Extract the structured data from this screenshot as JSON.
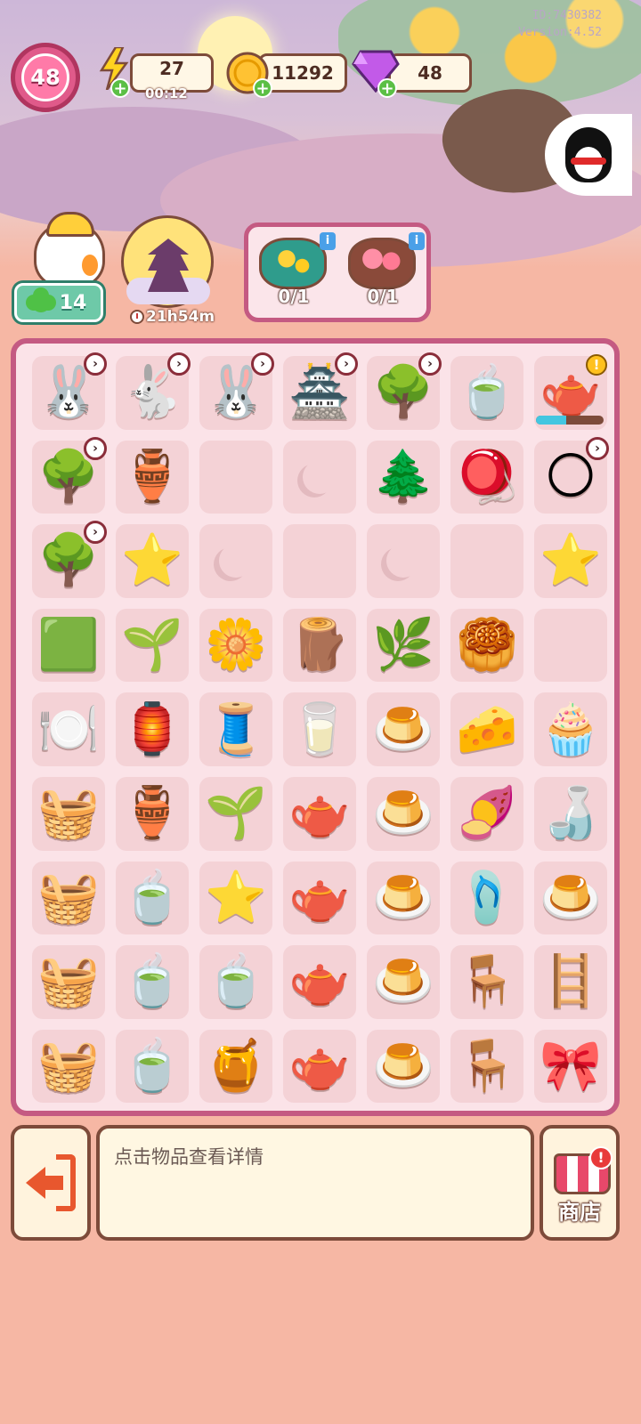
{
  "debug": {
    "id": "ID:7430382",
    "version": "Version:4.52"
  },
  "hud": {
    "level": "48",
    "energy": {
      "value": "27",
      "timer": "00:12"
    },
    "coins": {
      "value": "11292"
    },
    "gems": {
      "value": "48"
    },
    "plus": "+"
  },
  "character": {
    "clover_count": "14"
  },
  "event": {
    "time_left": "21h54m"
  },
  "orders": [
    {
      "count": "0/1",
      "icon": "osmanthus-leaf-plate",
      "info": "i"
    },
    {
      "count": "0/1",
      "icon": "flower-mooncake-box",
      "info": "i"
    }
  ],
  "board": {
    "rows": [
      [
        {
          "icon": "bunny-mortar-generator",
          "glyph": "🐰",
          "locked": true
        },
        {
          "icon": "bunny-golden-mortar-generator",
          "glyph": "🐇",
          "locked": true
        },
        {
          "icon": "grey-bunny-bucket-generator",
          "glyph": "🐰",
          "locked": true
        },
        {
          "icon": "blue-pavilion-generator",
          "glyph": "🏯",
          "locked": true
        },
        {
          "icon": "golden-osmanthus-tree-generator",
          "glyph": "🌳",
          "locked": true
        },
        {
          "icon": "bunny-teacup-item",
          "glyph": "🍵",
          "locked": false
        },
        {
          "icon": "red-teapot-generator",
          "glyph": "🫖",
          "locked": false,
          "alert": true,
          "progress": 0.45
        }
      ],
      [
        {
          "icon": "moon-tree-generator",
          "glyph": "🌳",
          "locked": true
        },
        {
          "icon": "starry-jar-item",
          "glyph": "🏺",
          "locked": false
        },
        {
          "icon": "empty",
          "glyph": "",
          "locked": false,
          "empty": true
        },
        {
          "icon": "empty-moon-slot",
          "glyph": "",
          "locked": false,
          "empty": true,
          "moon": true
        },
        {
          "icon": "bonsai-tree-item",
          "glyph": "🌲",
          "locked": false
        },
        {
          "icon": "wooden-spinning-top-item",
          "glyph": "🪀",
          "locked": false
        },
        {
          "icon": "full-moon-item",
          "glyph": "🌕",
          "locked": true
        }
      ],
      [
        {
          "icon": "moon-tree-generator",
          "glyph": "🌳",
          "locked": true
        },
        {
          "icon": "star-chest-item",
          "glyph": "⭐",
          "locked": false
        },
        {
          "icon": "empty-moon-slot",
          "glyph": "",
          "locked": false,
          "empty": true,
          "moon": true
        },
        {
          "icon": "empty",
          "glyph": "",
          "locked": false,
          "empty": true
        },
        {
          "icon": "empty-moon-slot",
          "glyph": "",
          "locked": false,
          "empty": true,
          "moon": true
        },
        {
          "icon": "empty",
          "glyph": "",
          "locked": false,
          "empty": true
        },
        {
          "icon": "small-star-item",
          "glyph": "⭐",
          "locked": false
        }
      ],
      [
        {
          "icon": "green-tray-item",
          "glyph": "🟩",
          "locked": false
        },
        {
          "icon": "sprout-item",
          "glyph": "🌱",
          "locked": false
        },
        {
          "icon": "osmanthus-flowers-item",
          "glyph": "🌼",
          "locked": false
        },
        {
          "icon": "branch-item",
          "glyph": "🪵",
          "locked": false
        },
        {
          "icon": "osmanthus-twig-item",
          "glyph": "🌿",
          "locked": false
        },
        {
          "icon": "mooncake-item",
          "glyph": "🥮",
          "locked": false
        },
        {
          "icon": "empty",
          "glyph": "",
          "locked": false,
          "empty": true
        }
      ],
      [
        {
          "icon": "jade-plate-item",
          "glyph": "🍽️",
          "locked": false
        },
        {
          "icon": "golden-lantern-item",
          "glyph": "🏮",
          "locked": false
        },
        {
          "icon": "thread-spool-item",
          "glyph": "🧵",
          "locked": false
        },
        {
          "icon": "starry-cup-item",
          "glyph": "🥛",
          "locked": false
        },
        {
          "icon": "osmanthus-jelly-item",
          "glyph": "🍮",
          "locked": false
        },
        {
          "icon": "cheese-mooncake-item",
          "glyph": "🧀",
          "locked": false
        },
        {
          "icon": "bunny-cupcake-item",
          "glyph": "🧁",
          "locked": false
        }
      ],
      [
        {
          "icon": "osmanthus-basket-item",
          "glyph": "🧺",
          "locked": false
        },
        {
          "icon": "lantern-vase-item",
          "glyph": "🏺",
          "locked": false
        },
        {
          "icon": "blue-sapling-item",
          "glyph": "🌱",
          "locked": false
        },
        {
          "icon": "porcelain-tea-set-item",
          "glyph": "🫖",
          "locked": false
        },
        {
          "icon": "osmanthus-jelly-item",
          "glyph": "🍮",
          "locked": false
        },
        {
          "icon": "taro-mooncake-item",
          "glyph": "🍠",
          "locked": false
        },
        {
          "icon": "wine-bottle-item",
          "glyph": "🍶",
          "locked": false
        }
      ],
      [
        {
          "icon": "osmanthus-basket-item",
          "glyph": "🧺",
          "locked": false
        },
        {
          "icon": "bunny-teacup-item",
          "glyph": "🍵",
          "locked": false
        },
        {
          "icon": "star-basket-item",
          "glyph": "⭐",
          "locked": false
        },
        {
          "icon": "porcelain-tea-set-item",
          "glyph": "🫖",
          "locked": false
        },
        {
          "icon": "osmanthus-jelly-item",
          "glyph": "🍮",
          "locked": false
        },
        {
          "icon": "bunny-slippers-item",
          "glyph": "🩴",
          "locked": false
        },
        {
          "icon": "osmanthus-jelly-item",
          "glyph": "🍮",
          "locked": false
        }
      ],
      [
        {
          "icon": "osmanthus-basket-item",
          "glyph": "🧺",
          "locked": false
        },
        {
          "icon": "bunny-teacup-item",
          "glyph": "🍵",
          "locked": false
        },
        {
          "icon": "bunny-teacup-item",
          "glyph": "🍵",
          "locked": false
        },
        {
          "icon": "porcelain-tea-set-item",
          "glyph": "🫖",
          "locked": false
        },
        {
          "icon": "osmanthus-jelly-item",
          "glyph": "🍮",
          "locked": false
        },
        {
          "icon": "weaving-loom-item",
          "glyph": "🪑",
          "locked": false
        },
        {
          "icon": "wooden-rack-item",
          "glyph": "🪜",
          "locked": false
        }
      ],
      [
        {
          "icon": "osmanthus-basket-item",
          "glyph": "🧺",
          "locked": false
        },
        {
          "icon": "bunny-teacup-item",
          "glyph": "🍵",
          "locked": false
        },
        {
          "icon": "honey-jar-item",
          "glyph": "🍯",
          "locked": false
        },
        {
          "icon": "porcelain-tea-set-item",
          "glyph": "🫖",
          "locked": false
        },
        {
          "icon": "osmanthus-jelly-item",
          "glyph": "🍮",
          "locked": false
        },
        {
          "icon": "weaving-loom-item",
          "glyph": "🪑",
          "locked": false
        },
        {
          "icon": "fabric-bundle-item",
          "glyph": "🎀",
          "locked": false
        }
      ]
    ]
  },
  "bottom": {
    "hint": "点击物品查看详情",
    "shop_label": "商店",
    "shop_alert": "!"
  },
  "colors": {
    "board_border": "#c45a82",
    "board_bg": "#fbe3e8",
    "page_bg": "#f6b7a4",
    "outline": "#7d4b3a"
  }
}
